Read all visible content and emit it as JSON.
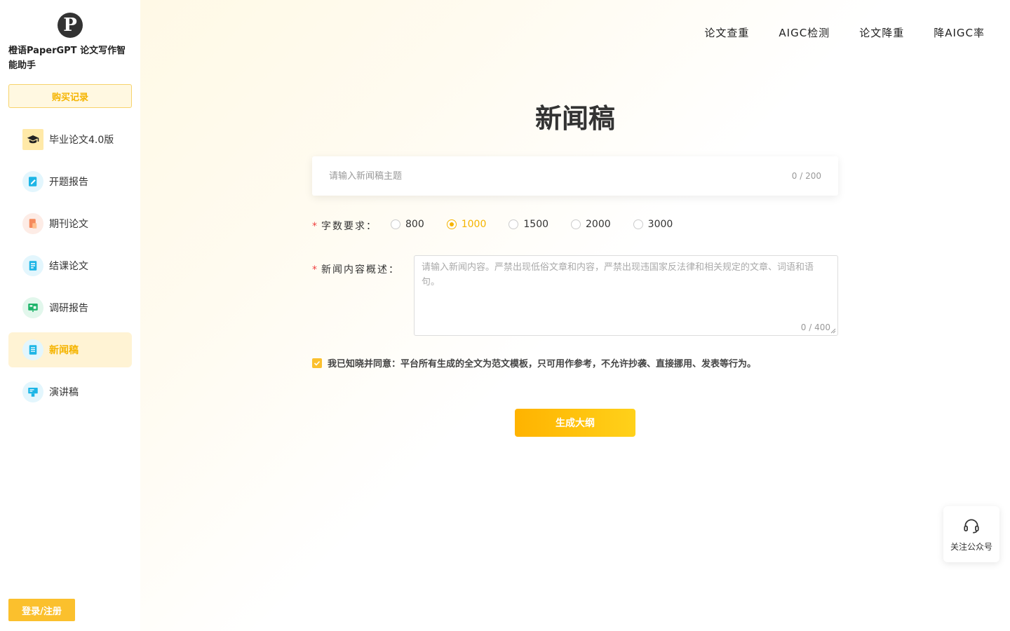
{
  "brand": {
    "logo_letter": "P",
    "name": "橙语PaperGPT 论文写作智能助手"
  },
  "sidebar": {
    "purchase_label": "购买记录",
    "items": [
      {
        "label": "毕业论文4.0版",
        "icon": "graduation-cap-icon",
        "active": false
      },
      {
        "label": "开题报告",
        "icon": "report-edit-icon",
        "active": false
      },
      {
        "label": "期刊论文",
        "icon": "journal-icon",
        "active": false
      },
      {
        "label": "结课论文",
        "icon": "document-list-icon",
        "active": false
      },
      {
        "label": "调研报告",
        "icon": "presentation-chart-icon",
        "active": false
      },
      {
        "label": "新闻稿",
        "icon": "news-document-icon",
        "active": true
      },
      {
        "label": "演讲稿",
        "icon": "speech-podium-icon",
        "active": false
      }
    ],
    "login_label": "登录/注册"
  },
  "topnav": [
    "论文查重",
    "AIGC检测",
    "论文降重",
    "降AIGC率"
  ],
  "page": {
    "title": "新闻稿",
    "topic_placeholder": "请输入新闻稿主题",
    "topic_counter": "0 / 200",
    "word_label": "字数要求：",
    "word_options": [
      "800",
      "1000",
      "1500",
      "2000",
      "3000"
    ],
    "word_selected": "1000",
    "content_label": "新闻内容概述：",
    "content_placeholder": "请输入新闻内容。严禁出现低俗文章和内容，严禁出现违国家反法律和相关规定的文章、词语和语句。",
    "content_counter": "0 / 400",
    "agree_text": "我已知晓并同意：平台所有生成的全文为范文模板，只可用作参考，不允许抄袭、直接挪用、发表等行为。",
    "generate_label": "生成大纲"
  },
  "follow_widget": {
    "label": "关注公众号",
    "icon": "headset-icon"
  },
  "colors": {
    "accent": "#f5b400",
    "accent_bg": "#fff3d4",
    "required": "#f04040"
  }
}
